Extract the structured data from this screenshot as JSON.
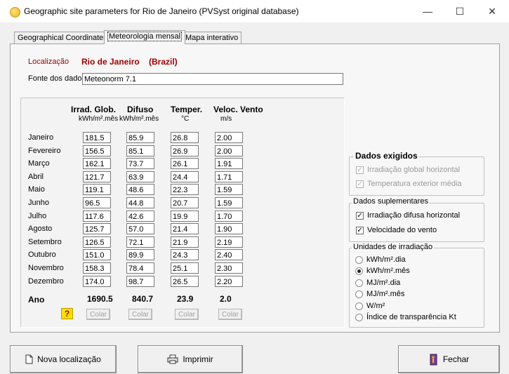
{
  "window": {
    "title": "Geographic site parameters for Rio de Janeiro (PVSyst original database)",
    "minimize": "—",
    "maximize": "☐",
    "close": "✕"
  },
  "tabs": [
    {
      "label": "Geographical Coordinates"
    },
    {
      "label": "Meteorologia mensal"
    },
    {
      "label": "Mapa interativo"
    }
  ],
  "location": {
    "label": "Localização",
    "city": "Rio de Janeiro",
    "country": "(Brazil)"
  },
  "source": {
    "label": "Fonte dos dados",
    "value": "Meteonorm 7.1"
  },
  "table": {
    "headers": [
      {
        "title": "Irrad. Glob.",
        "unit": "kWh/m².mês"
      },
      {
        "title": "Difuso",
        "unit": "kWh/m².mês"
      },
      {
        "title": "Temper.",
        "unit": "°C"
      },
      {
        "title": "Veloc. Vento",
        "unit": "m/s"
      }
    ],
    "rows": [
      {
        "month": "Janeiro",
        "glob": "181.5",
        "dif": "85.9",
        "temp": "26.8",
        "wind": "2.00"
      },
      {
        "month": "Fevereiro",
        "glob": "156.5",
        "dif": "85.1",
        "temp": "26.9",
        "wind": "2.00"
      },
      {
        "month": "Março",
        "glob": "162.1",
        "dif": "73.7",
        "temp": "26.1",
        "wind": "1.91"
      },
      {
        "month": "Abril",
        "glob": "121.7",
        "dif": "63.9",
        "temp": "24.4",
        "wind": "1.71"
      },
      {
        "month": "Maio",
        "glob": "119.1",
        "dif": "48.6",
        "temp": "22.3",
        "wind": "1.59"
      },
      {
        "month": "Junho",
        "glob": "96.5",
        "dif": "44.8",
        "temp": "20.7",
        "wind": "1.59"
      },
      {
        "month": "Julho",
        "glob": "117.6",
        "dif": "42.6",
        "temp": "19.9",
        "wind": "1.70"
      },
      {
        "month": "Agosto",
        "glob": "125.7",
        "dif": "57.0",
        "temp": "21.4",
        "wind": "1.90"
      },
      {
        "month": "Setembro",
        "glob": "126.5",
        "dif": "72.1",
        "temp": "21.9",
        "wind": "2.19"
      },
      {
        "month": "Outubro",
        "glob": "151.0",
        "dif": "89.9",
        "temp": "24.3",
        "wind": "2.40"
      },
      {
        "month": "Novembro",
        "glob": "158.3",
        "dif": "78.4",
        "temp": "25.1",
        "wind": "2.30"
      },
      {
        "month": "Dezembro",
        "glob": "174.0",
        "dif": "98.7",
        "temp": "26.5",
        "wind": "2.20"
      }
    ],
    "year": {
      "label": "Ano",
      "glob": "1690.5",
      "dif": "840.7",
      "temp": "23.9",
      "wind": "2.0"
    },
    "help": "?",
    "paste_label": "Colar"
  },
  "dados_exigidos": {
    "title": "Dados exigidos",
    "items": [
      {
        "label": "Irradiação global horizontal",
        "checked": true
      },
      {
        "label": "Temperatura exterior média",
        "checked": true
      }
    ]
  },
  "dados_suplementares": {
    "title": "Dados suplementares",
    "items": [
      {
        "label": "Irradiação difusa horizontal",
        "checked": true
      },
      {
        "label": "Velocidade do vento",
        "checked": true
      }
    ]
  },
  "unidades": {
    "title": "Unidades de irradiação",
    "options": [
      {
        "label": "kWh/m².dia",
        "selected": false
      },
      {
        "label": "kWh/m².mês",
        "selected": true
      },
      {
        "label": "MJ/m².dia",
        "selected": false
      },
      {
        "label": "MJ/m².mês",
        "selected": false
      },
      {
        "label": "W/m²",
        "selected": false
      },
      {
        "label": "Índice de transparência Kt",
        "selected": false
      }
    ]
  },
  "buttons": {
    "new_location": "Nova localização",
    "print": "Imprimir",
    "close": "Fechar"
  },
  "colors": {
    "location_text": "#a00000",
    "panel_bg": "#f7f7f7",
    "window_bg": "#f0f0f0"
  }
}
